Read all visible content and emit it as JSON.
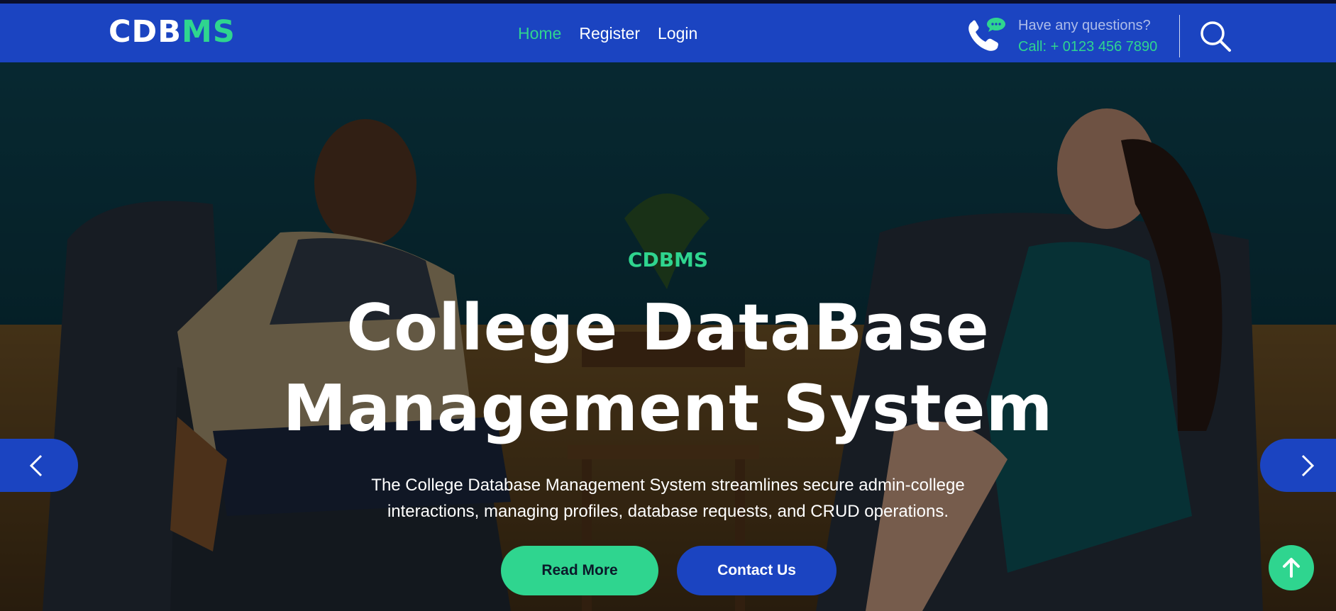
{
  "brand": {
    "part1": "CDB",
    "part2": "MS"
  },
  "nav": {
    "items": [
      {
        "label": "Home",
        "active": true
      },
      {
        "label": "Register",
        "active": false
      },
      {
        "label": "Login",
        "active": false
      }
    ]
  },
  "contact": {
    "question": "Have any questions?",
    "call": "Call: + 0123 456 7890",
    "icon": "phone-chat-icon"
  },
  "search": {
    "icon": "search-icon"
  },
  "hero": {
    "eyebrow": "CDBMS",
    "title_line1": "College DataBase",
    "title_line2": "Management System",
    "description": "The College Database Management System streamlines secure admin-college interactions, managing profiles, database requests, and CRUD operations.",
    "read_more_label": "Read More",
    "contact_label": "Contact Us"
  },
  "colors": {
    "primary": "#1b44c1",
    "accent": "#2fd58f",
    "text_light": "#ffffff"
  }
}
